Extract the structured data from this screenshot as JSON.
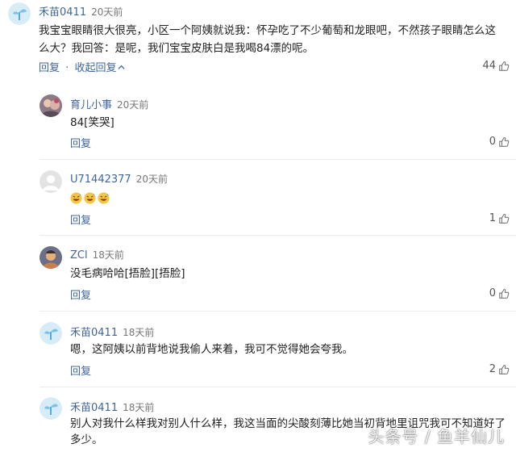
{
  "main": {
    "author": "禾苗0411",
    "time": "20天前",
    "text": "我宝宝眼睛很大很亮，小区一个阿姨就说我：怀孕吃了不少葡萄和龙眼吧，不然孩子眼睛怎么这么大？我回答：是呢，我们宝宝皮肤白是我喝84漂的呢。",
    "reply_label": "回复",
    "separator": "·",
    "collapse_label": "收起回复",
    "collapse_icon": "chevron-up-icon",
    "likes": "44"
  },
  "replies": [
    {
      "author": "育儿小事",
      "time": "20天前",
      "text": "84[笑哭]",
      "reply_label": "回复",
      "likes": "0",
      "avatar": "photo-avatar"
    },
    {
      "author": "U71442377",
      "time": "20天前",
      "text": "",
      "emoji_icon": "grinning-sweat-emoji",
      "emoji_count": 3,
      "reply_label": "回复",
      "likes": "1",
      "avatar": "default-user-avatar"
    },
    {
      "author": "ZCl",
      "time": "18天前",
      "text": "没毛病哈哈[捂脸][捂脸]",
      "reply_label": "回复",
      "likes": "0",
      "avatar": "photo-avatar"
    },
    {
      "author": "禾苗0411",
      "time": "18天前",
      "text": "嗯，这阿姨以前背地说我偷人来着，我可不觉得她会夸我。",
      "reply_label": "回复",
      "likes": "2",
      "avatar": "sprout-avatar"
    },
    {
      "author": "禾苗0411",
      "time": "18天前",
      "text": "别人对我什么样我对别人什么样，我这当面的尖酸刻薄比她当初背地里诅咒我可不知道好了多少。",
      "avatar": "sprout-avatar"
    }
  ],
  "watermark": "头条号 / 鱼羊仙儿",
  "colors": {
    "link": "#406599",
    "text": "#222222",
    "meta": "#777777"
  }
}
